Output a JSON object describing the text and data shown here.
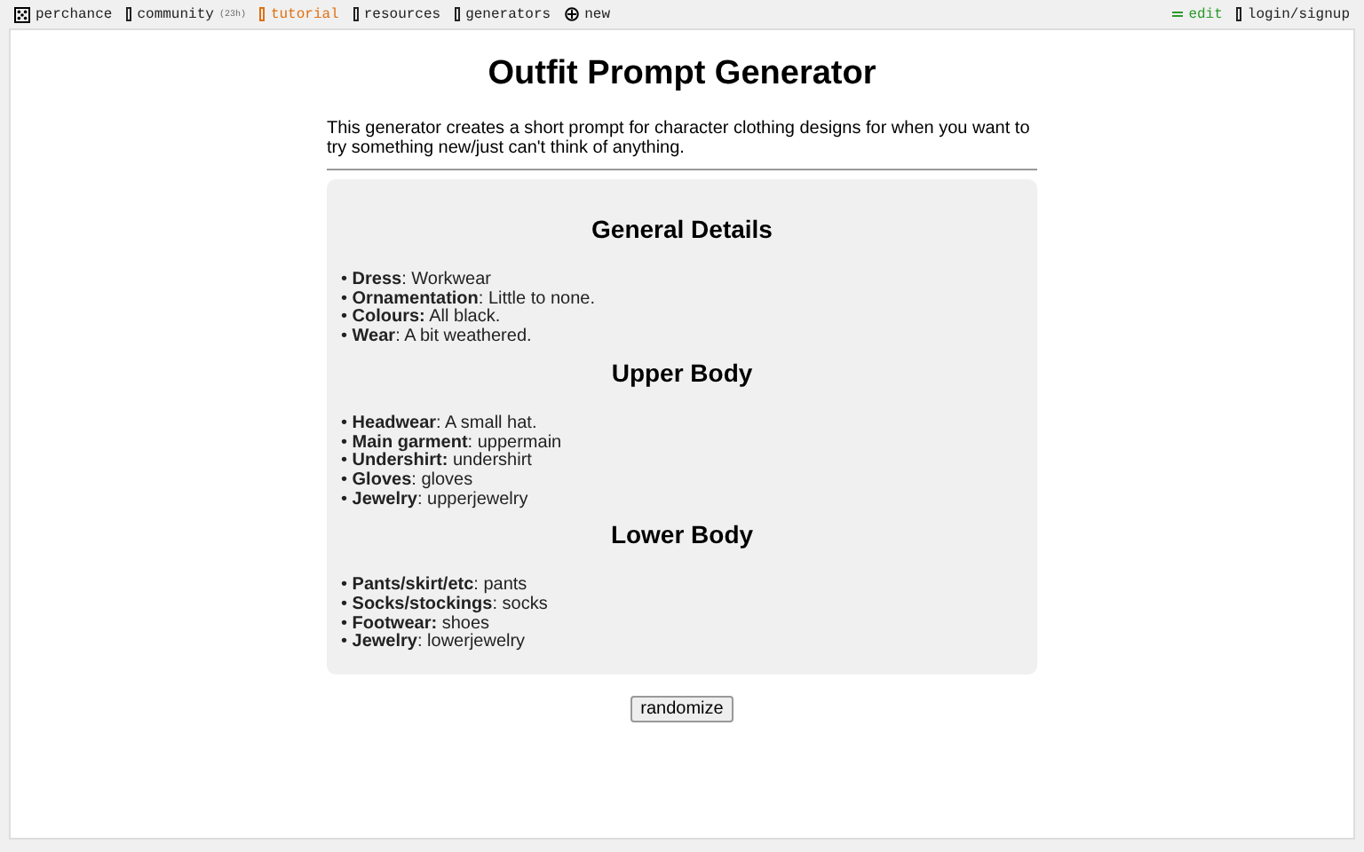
{
  "nav": {
    "left": [
      {
        "label": "perchance",
        "kind": "dice",
        "highlighted": false
      },
      {
        "label": "community",
        "note": "(23h)",
        "kind": "box",
        "highlighted": false
      },
      {
        "label": "tutorial",
        "kind": "box",
        "highlighted": true
      },
      {
        "label": "resources",
        "kind": "box",
        "highlighted": false
      },
      {
        "label": "generators",
        "kind": "box",
        "highlighted": false
      },
      {
        "label": "new",
        "kind": "plus",
        "highlighted": false
      }
    ],
    "right": [
      {
        "label": "edit",
        "kind": "edit"
      },
      {
        "label": "login/signup",
        "kind": "plain"
      }
    ]
  },
  "title": "Outfit Prompt Generator",
  "description": "This generator creates a short prompt for character clothing designs for when you want to try something new/just can't think of anything.",
  "sections": [
    {
      "heading": "General Details",
      "items": [
        "• **Dress**: Workwear",
        "• **Ornamentation**: Little to none.",
        "• **Colours:** All black.",
        "• **Wear**: A bit weathered."
      ]
    },
    {
      "heading": "Upper Body",
      "items": [
        "• **Headwear**: A small hat.",
        "• **Main garment**: uppermain",
        "• **Undershirt:** undershirt",
        "• **Gloves**: gloves",
        "• **Jewelry**: upperjewelry"
      ]
    },
    {
      "heading": "Lower Body",
      "items": [
        "• **Pants/skirt/etc**: pants",
        "• **Socks/stockings**: socks",
        "• **Footwear:** shoes",
        "• **Jewelry**: lowerjewelry"
      ]
    }
  ],
  "button": "randomize"
}
